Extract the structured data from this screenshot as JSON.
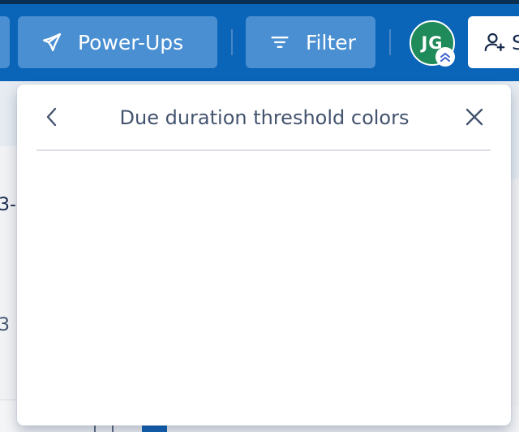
{
  "header": {
    "powerups_label": "Power-Ups",
    "filter_label": "Filter",
    "avatar_initials": "JG",
    "share_label": "S",
    "colors": {
      "topbar": "#0a64b8",
      "button": "#4a8fd2",
      "avatar": "#1f8a5a",
      "badge_accent": "#3a5fd0"
    }
  },
  "background": {
    "card_text_1": "3-",
    "card_text_2": "3"
  },
  "popover": {
    "title": "Due duration threshold colors",
    "back_icon": "chevron-left-icon",
    "close_icon": "close-icon"
  }
}
